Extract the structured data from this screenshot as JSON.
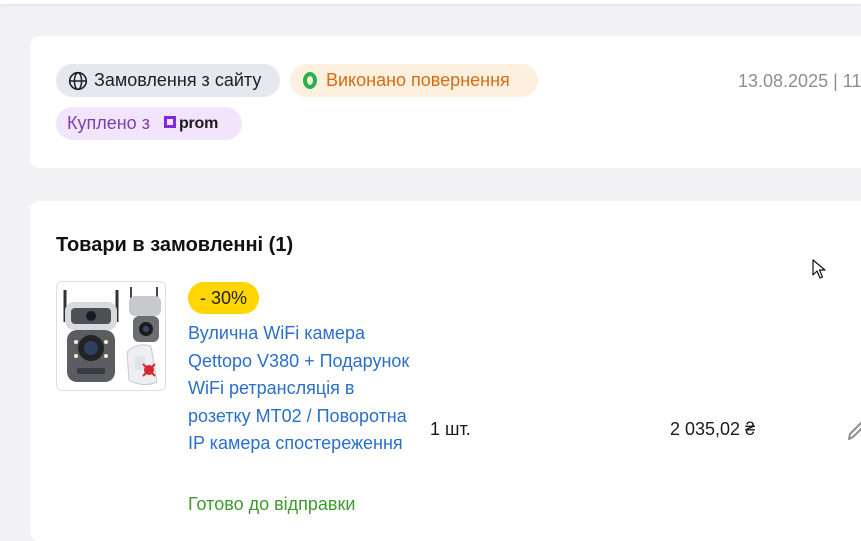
{
  "order": {
    "source_label": "Замовлення з сайту",
    "status_label": "Виконано повернення",
    "bought_from_label": "Куплено з",
    "marketplace_logo_text": "prom",
    "date_text": "13.08.2025 | 11",
    "colors": {
      "status_text": "#d76a13",
      "status_dot": "#2bb34a",
      "bought_text": "#7b3fb2",
      "prom_brand": "#7a2ae0"
    }
  },
  "items_section": {
    "title": "Товари в замовленні (1)",
    "items": [
      {
        "discount": "- 30%",
        "name": "Вулична WiFi камера Qettopo V380 + Подарунок WiFi ретрансляція в розетку MT02 / Поворотна IP камера спостереження",
        "status": "Готово до відправки",
        "quantity": "1 шт.",
        "price": "2 035,02 ₴",
        "thumbnail_icon": "security-camera-image"
      }
    ]
  },
  "icons": {
    "source": "globe-icon",
    "status": "status-ring-icon",
    "edit": "pencil-icon",
    "cursor": "mouse-pointer-icon"
  }
}
